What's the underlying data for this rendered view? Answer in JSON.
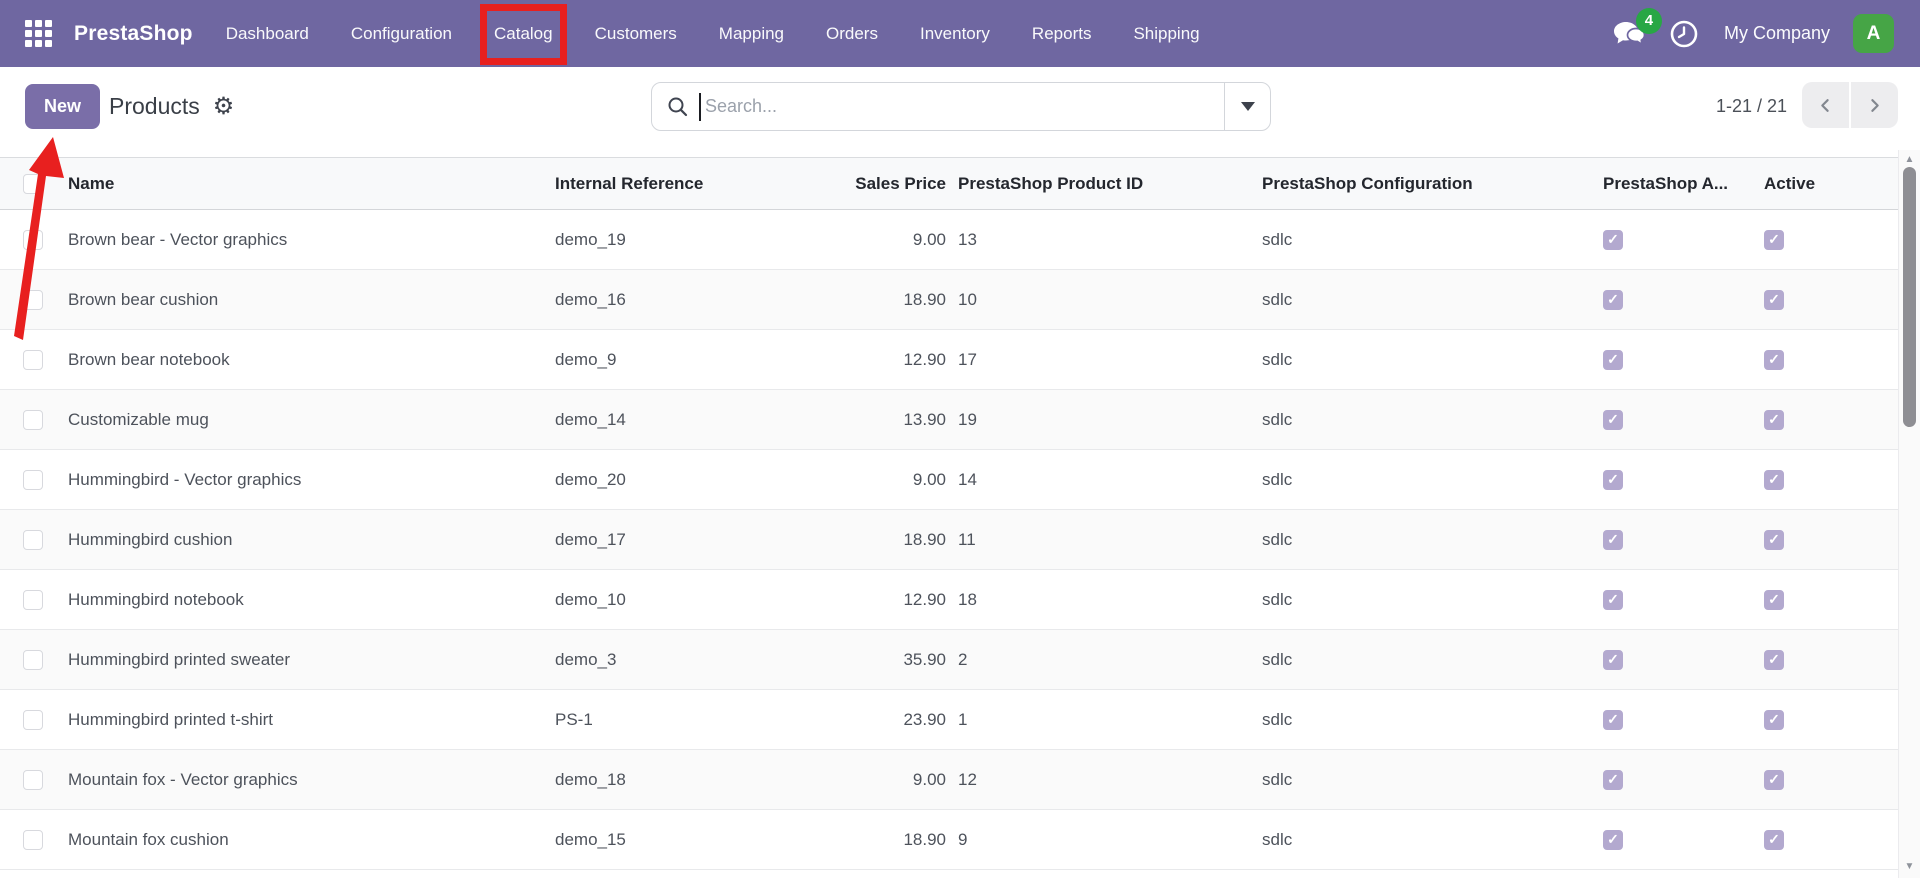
{
  "topbar": {
    "brand": "PrestaShop",
    "menus": [
      "Dashboard",
      "Configuration",
      "Catalog",
      "Customers",
      "Mapping",
      "Orders",
      "Inventory",
      "Reports",
      "Shipping"
    ],
    "highlighted_menu": "Catalog",
    "notification_count": "4",
    "company_name": "My Company",
    "avatar_letter": "A"
  },
  "control_bar": {
    "new_button_label": "New",
    "page_title": "Products",
    "search_placeholder": "Search...",
    "pager_range": "1-21 / 21"
  },
  "table": {
    "headers": {
      "name": "Name",
      "internal_reference": "Internal Reference",
      "sales_price": "Sales Price",
      "prestashop_product_id": "PrestaShop Product ID",
      "prestashop_configuration": "PrestaShop Configuration",
      "prestashop_active": "PrestaShop A...",
      "active": "Active"
    },
    "rows": [
      {
        "name": "Brown bear - Vector graphics",
        "internal_reference": "demo_19",
        "sales_price": "9.00",
        "prestashop_product_id": "13",
        "prestashop_configuration": "sdlc",
        "prestashop_active": true,
        "active": true
      },
      {
        "name": "Brown bear cushion",
        "internal_reference": "demo_16",
        "sales_price": "18.90",
        "prestashop_product_id": "10",
        "prestashop_configuration": "sdlc",
        "prestashop_active": true,
        "active": true
      },
      {
        "name": "Brown bear notebook",
        "internal_reference": "demo_9",
        "sales_price": "12.90",
        "prestashop_product_id": "17",
        "prestashop_configuration": "sdlc",
        "prestashop_active": true,
        "active": true
      },
      {
        "name": "Customizable mug",
        "internal_reference": "demo_14",
        "sales_price": "13.90",
        "prestashop_product_id": "19",
        "prestashop_configuration": "sdlc",
        "prestashop_active": true,
        "active": true
      },
      {
        "name": "Hummingbird - Vector graphics",
        "internal_reference": "demo_20",
        "sales_price": "9.00",
        "prestashop_product_id": "14",
        "prestashop_configuration": "sdlc",
        "prestashop_active": true,
        "active": true
      },
      {
        "name": "Hummingbird cushion",
        "internal_reference": "demo_17",
        "sales_price": "18.90",
        "prestashop_product_id": "11",
        "prestashop_configuration": "sdlc",
        "prestashop_active": true,
        "active": true
      },
      {
        "name": "Hummingbird notebook",
        "internal_reference": "demo_10",
        "sales_price": "12.90",
        "prestashop_product_id": "18",
        "prestashop_configuration": "sdlc",
        "prestashop_active": true,
        "active": true
      },
      {
        "name": "Hummingbird printed sweater",
        "internal_reference": "demo_3",
        "sales_price": "35.90",
        "prestashop_product_id": "2",
        "prestashop_configuration": "sdlc",
        "prestashop_active": true,
        "active": true
      },
      {
        "name": "Hummingbird printed t-shirt",
        "internal_reference": "PS-1",
        "sales_price": "23.90",
        "prestashop_product_id": "1",
        "prestashop_configuration": "sdlc",
        "prestashop_active": true,
        "active": true
      },
      {
        "name": "Mountain fox - Vector graphics",
        "internal_reference": "demo_18",
        "sales_price": "9.00",
        "prestashop_product_id": "12",
        "prestashop_configuration": "sdlc",
        "prestashop_active": true,
        "active": true
      },
      {
        "name": "Mountain fox cushion",
        "internal_reference": "demo_15",
        "sales_price": "18.90",
        "prestashop_product_id": "9",
        "prestashop_configuration": "sdlc",
        "prestashop_active": true,
        "active": true
      }
    ]
  },
  "annotations": {
    "boxed_menu": "Catalog",
    "arrow_points_to": "New button",
    "highlight_color": "#E8201F"
  },
  "colors": {
    "topbar_bg": "#6F67A1",
    "primary_button_bg": "#7A6EA8",
    "avatar_bg": "#46A546",
    "badge_bg": "#28A745",
    "checkbox_checked_bg": "#B3A9CF"
  }
}
